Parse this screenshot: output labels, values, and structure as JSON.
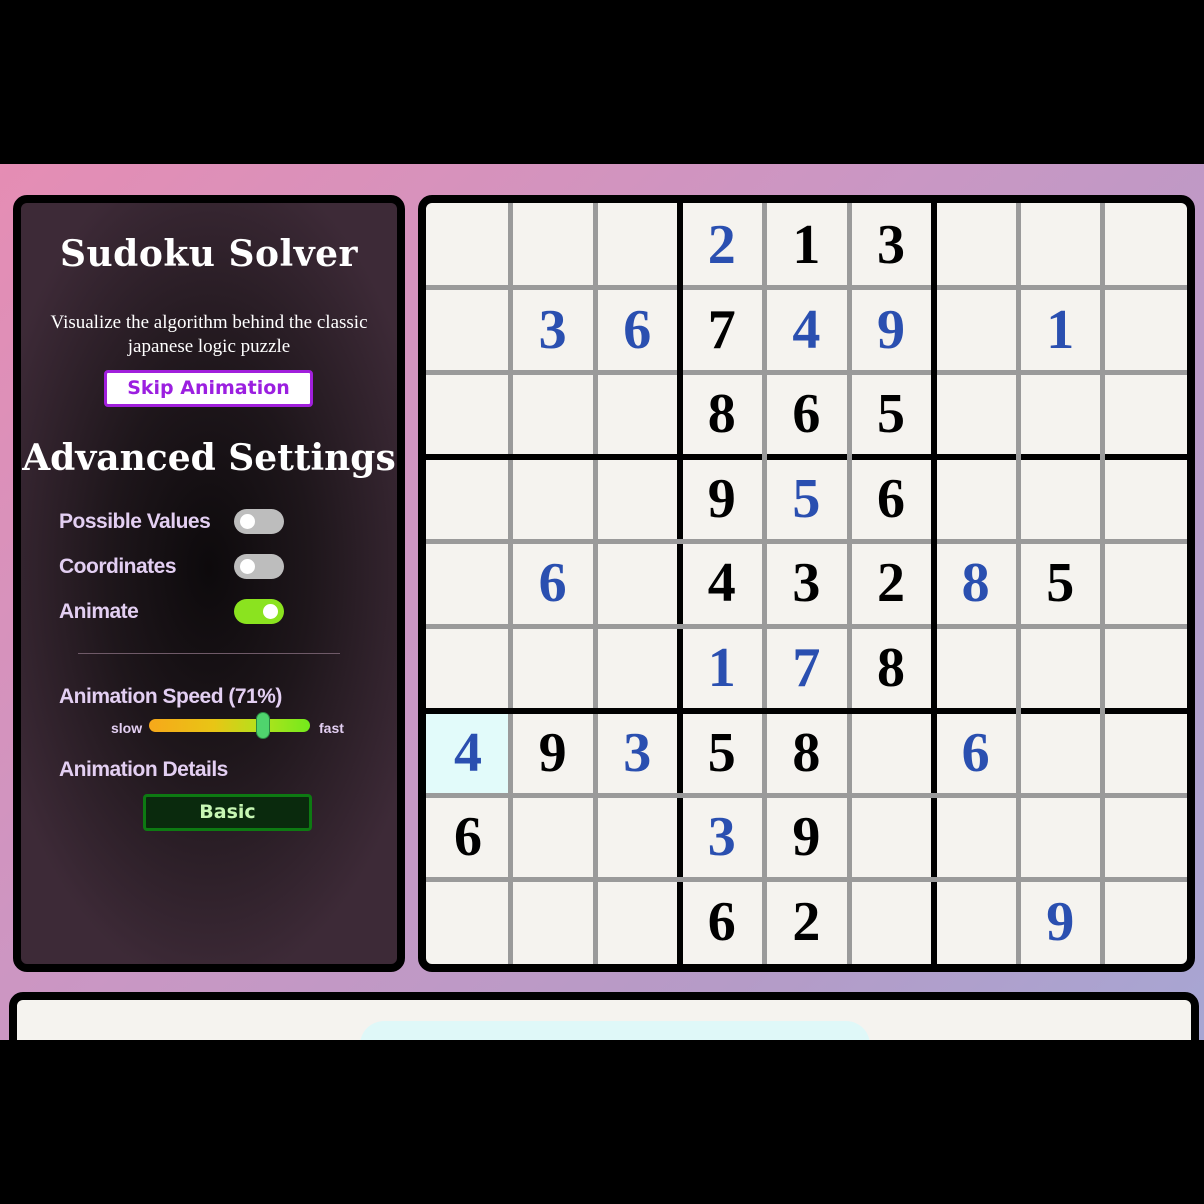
{
  "sidebar": {
    "title": "Sudoku Solver",
    "subtitle": "Visualize the algorithm behind the classic japanese logic puzzle",
    "skip_label": "Skip Animation",
    "advanced_title": "Advanced Settings",
    "settings": [
      {
        "label": "Possible Values",
        "enabled": false
      },
      {
        "label": "Coordinates",
        "enabled": false
      },
      {
        "label": "Animate",
        "enabled": true
      }
    ],
    "speed_label": "Animation Speed (71%)",
    "speed_percent": 71,
    "speed_min_label": "slow",
    "speed_max_label": "fast",
    "details_label": "Animation Details",
    "details_value": "Basic"
  },
  "colors": {
    "given": "#000000",
    "solved": "#2a4fb0",
    "active_cell": "#e2fbfa",
    "toggle_on": "#8be31f",
    "toggle_off": "#bdbdbd"
  },
  "board": {
    "rows": [
      [
        "",
        "",
        "",
        "2",
        "1",
        "3",
        "",
        "",
        ""
      ],
      [
        "",
        "3",
        "6",
        "7",
        "4",
        "9",
        "",
        "1",
        ""
      ],
      [
        "",
        "",
        "",
        "8",
        "6",
        "5",
        "",
        "",
        ""
      ],
      [
        "",
        "",
        "",
        "9",
        "5",
        "6",
        "",
        "",
        ""
      ],
      [
        "",
        "6",
        "",
        "4",
        "3",
        "2",
        "8",
        "5",
        ""
      ],
      [
        "",
        "",
        "",
        "1",
        "7",
        "8",
        "",
        "",
        ""
      ],
      [
        "4",
        "9",
        "3",
        "5",
        "8",
        "",
        "6",
        "",
        ""
      ],
      [
        "6",
        "",
        "",
        "3",
        "9",
        "",
        "",
        "",
        ""
      ],
      [
        "",
        "",
        "",
        "6",
        "2",
        "",
        "",
        "9",
        ""
      ]
    ],
    "solved_cells": [
      [
        0,
        3
      ],
      [
        1,
        1
      ],
      [
        1,
        2
      ],
      [
        1,
        4
      ],
      [
        1,
        5
      ],
      [
        1,
        7
      ],
      [
        3,
        4
      ],
      [
        4,
        1
      ],
      [
        4,
        6
      ],
      [
        5,
        3
      ],
      [
        5,
        4
      ],
      [
        6,
        0
      ],
      [
        6,
        2
      ],
      [
        6,
        6
      ],
      [
        7,
        3
      ],
      [
        8,
        7
      ]
    ],
    "active_cell": [
      6,
      0
    ]
  }
}
